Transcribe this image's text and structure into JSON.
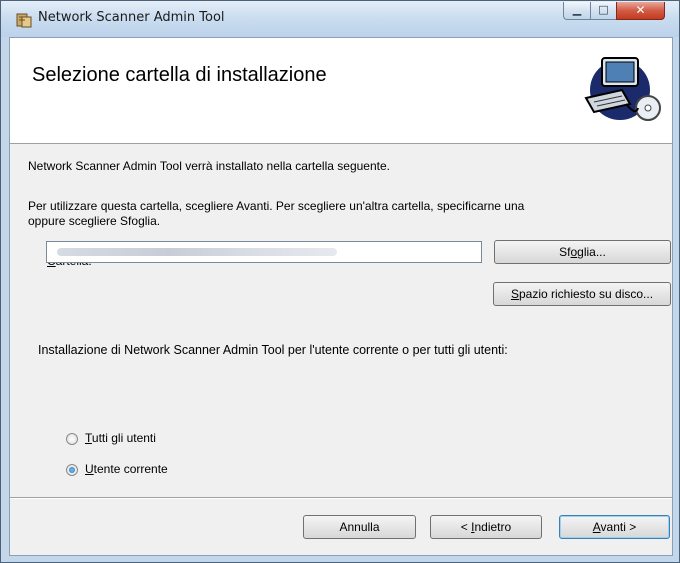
{
  "window": {
    "title": "Network Scanner Admin Tool",
    "minimize_glyph": "▁",
    "maximize_glyph": "□",
    "close_glyph": "✕"
  },
  "banner": {
    "title": "Selezione cartella di installazione",
    "art_icon": "computer-installer-icon"
  },
  "body": {
    "intro": "Network Scanner Admin Tool verrà installato nella cartella seguente.",
    "instructions_line1": "Per utilizzare questa cartella, scegliere Avanti. Per scegliere un'altra cartella, specificarne una",
    "instructions_line2": "oppure scegliere Sfoglia.",
    "folder_label_accel": "C",
    "folder_label_rest": "artella:",
    "browse_pre": "Sf",
    "browse_accel": "o",
    "browse_post": "glia...",
    "disk_space_accel": "S",
    "disk_space_rest": "pazio richiesto su disco...",
    "scope_question": "Installazione di Network Scanner Admin Tool per l'utente corrente o per tutti gli utenti:",
    "radio_all_accel": "T",
    "radio_all_rest": "utti gli utenti",
    "radio_current_accel": "U",
    "radio_current_rest": "tente corrente",
    "selected_option": "Utente corrente"
  },
  "footer": {
    "cancel": "Annulla",
    "back_pre": "< ",
    "back_accel": "I",
    "back_rest": "ndietro",
    "next_accel": "A",
    "next_rest": "vanti >"
  }
}
